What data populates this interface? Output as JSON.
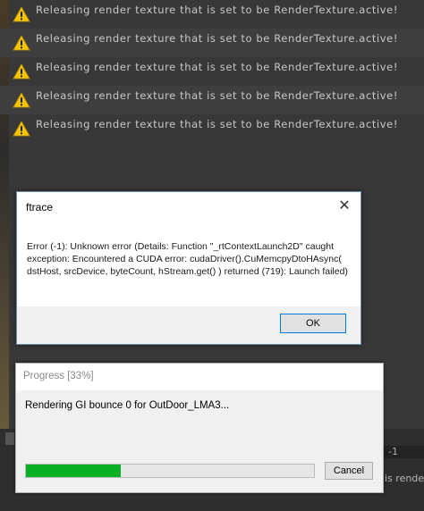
{
  "console": {
    "entries": [
      {
        "message": "Releasing render texture that is set to be RenderTexture.active!",
        "icon": "warning-icon"
      },
      {
        "message": "Releasing render texture that is set to be RenderTexture.active!",
        "icon": "warning-icon"
      },
      {
        "message": "Releasing render texture that is set to be RenderTexture.active!",
        "icon": "warning-icon"
      },
      {
        "message": "Releasing render texture that is set to be RenderTexture.active!",
        "icon": "warning-icon"
      },
      {
        "message": "Releasing render texture that is set to be RenderTexture.active!",
        "icon": "warning-icon"
      }
    ]
  },
  "background": {
    "side_field_value": "-1",
    "side_text": "is render"
  },
  "error_dialog": {
    "title": "ftrace",
    "close_glyph": "✕",
    "message": "Error (-1): Unknown error (Details: Function \"_rtContextLaunch2D\" caught exception: Encountered a CUDA error: cudaDriver().CuMemcpyDtoHAsync( dstHost, srcDevice, byteCount, hStream.get() ) returned (719): Launch failed)",
    "ok_label": "OK"
  },
  "progress_dialog": {
    "title": "Progress [33%]",
    "status": "Rendering GI bounce 0 for OutDoor_LMA3...",
    "progress_fraction": 0.33,
    "cancel_label": "Cancel",
    "bar_color": "#06b025"
  },
  "colors": {
    "console_bg": "#383838",
    "warning": "#f5c400"
  }
}
